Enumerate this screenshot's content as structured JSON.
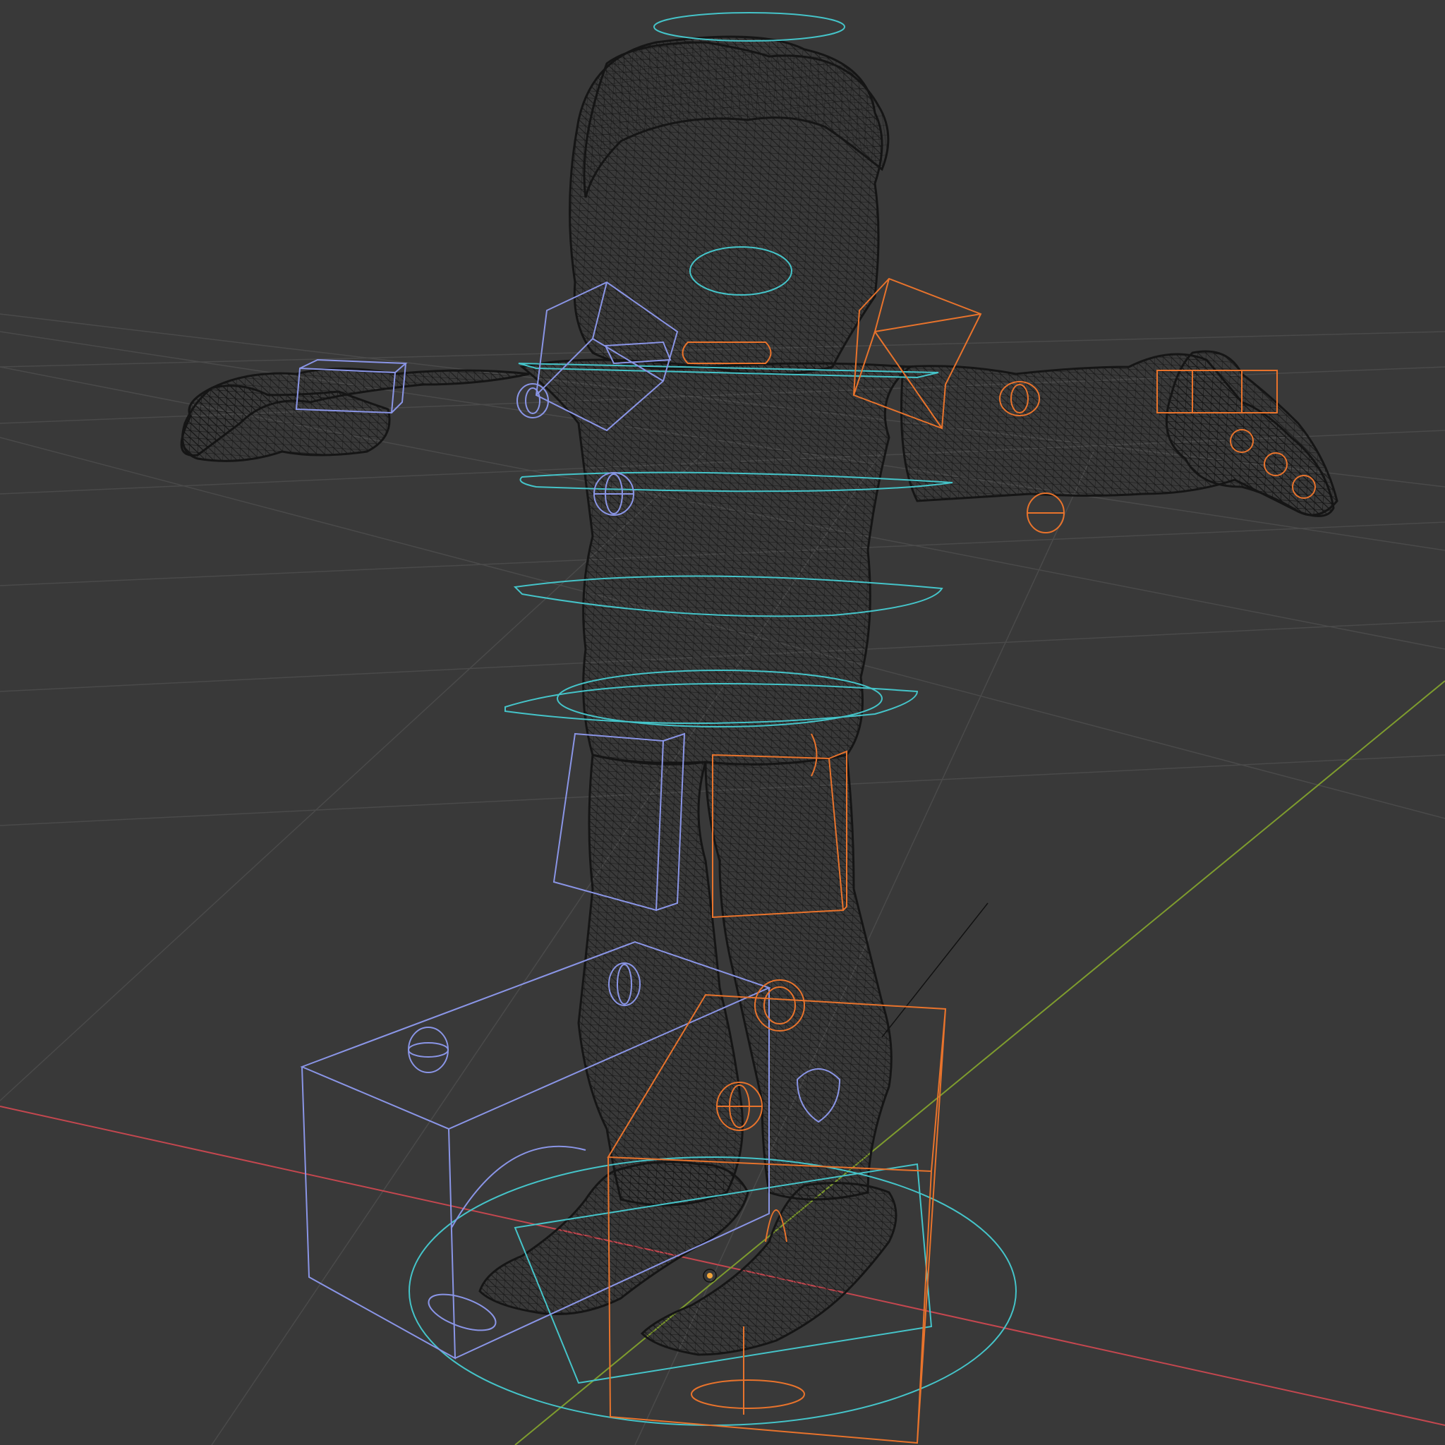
{
  "viewport": {
    "mode": "wireframe",
    "background_color": "#393939",
    "grid_color": "#4a4a4a",
    "axis_x_color": "#c4474f",
    "axis_y_color": "#7e9c2e",
    "mesh_wire_color": "#151515",
    "controls_left_color": "#8a95e6",
    "controls_right_color": "#e8732c",
    "controls_center_color": "#45c4c9",
    "origin_marker_color": "#f2a53a"
  },
  "scene": {
    "object": "character-mesh",
    "pose": "t-pose",
    "rig_controls": [
      "head-halo-control",
      "neck-control",
      "chest-control",
      "spine-control",
      "hips-control",
      "root-control",
      "shoulder-left-control",
      "shoulder-right-control",
      "hand-left-control",
      "hand-right-control",
      "thigh-left-control",
      "thigh-right-control",
      "foot-left-control",
      "foot-right-control",
      "knee-left-pole",
      "knee-right-pole"
    ]
  }
}
